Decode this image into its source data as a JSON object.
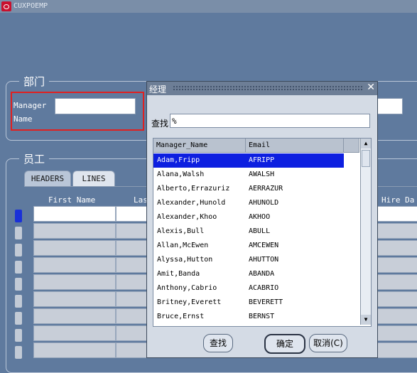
{
  "window": {
    "title": "CUXPOEMP"
  },
  "dept_section": {
    "label": "部门",
    "manager_label_1": "Manager",
    "manager_label_2": "Name"
  },
  "emp_section": {
    "label": "员工"
  },
  "tabs": [
    {
      "label": "HEADERS"
    },
    {
      "label": "LINES"
    }
  ],
  "columns": {
    "first_name": "First Name",
    "last_fragment": "Las",
    "hire_fragment": "Hire Da"
  },
  "dialog": {
    "title": "经理",
    "find_label": "查找",
    "find_value": "%",
    "headers": {
      "name": "Manager_Name",
      "email": "Email"
    },
    "rows": [
      {
        "name": "Adam,Fripp",
        "email": "AFRIPP"
      },
      {
        "name": "Alana,Walsh",
        "email": "AWALSH"
      },
      {
        "name": "Alberto,Errazuriz",
        "email": "AERRAZUR"
      },
      {
        "name": "Alexander,Hunold",
        "email": "AHUNOLD"
      },
      {
        "name": "Alexander,Khoo",
        "email": "AKHOO"
      },
      {
        "name": "Alexis,Bull",
        "email": "ABULL"
      },
      {
        "name": "Allan,McEwen",
        "email": "AMCEWEN"
      },
      {
        "name": "Alyssa,Hutton",
        "email": "AHUTTON"
      },
      {
        "name": "Amit,Banda",
        "email": "ABANDA"
      },
      {
        "name": "Anthony,Cabrio",
        "email": "ACABRIO"
      },
      {
        "name": "Britney,Everett",
        "email": "BEVERETT"
      },
      {
        "name": "Bruce,Ernst",
        "email": "BERNST"
      }
    ],
    "buttons": {
      "find": "查找",
      "ok": "确定",
      "cancel": "取消(C)"
    }
  }
}
